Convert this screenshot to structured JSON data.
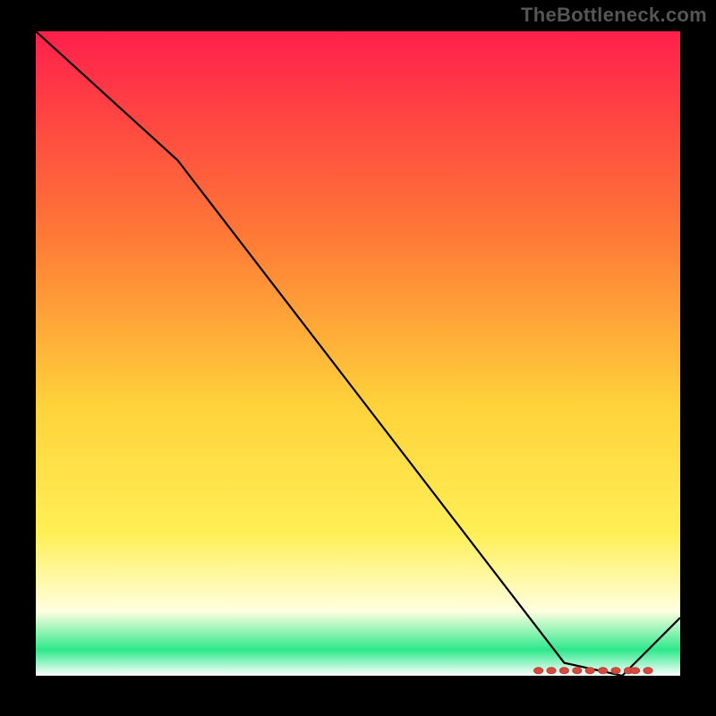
{
  "attribution": "TheBottleneck.com",
  "gradient": {
    "top": "#ff1f4b",
    "upper_mid": "#ff7a36",
    "mid": "#ffd23a",
    "lower_mid": "#ffef56",
    "pale": "#ffffe0",
    "green": "#2ee88b",
    "bottom_white": "#ffffff"
  },
  "chart_data": {
    "type": "line",
    "title": "",
    "xlabel": "",
    "ylabel": "",
    "xlim": [
      0,
      100
    ],
    "ylim": [
      0,
      100
    ],
    "series": [
      {
        "name": "bottleneck-curve",
        "x": [
          0,
          22,
          82,
          91,
          100
        ],
        "y": [
          100,
          80,
          2,
          0,
          9
        ]
      }
    ],
    "optimal_band": {
      "x_start": 78,
      "x_end": 95,
      "y": 0.8
    },
    "optimal_band_markers_x": [
      78,
      80,
      82,
      84,
      86,
      88,
      90,
      92,
      93,
      95
    ]
  }
}
